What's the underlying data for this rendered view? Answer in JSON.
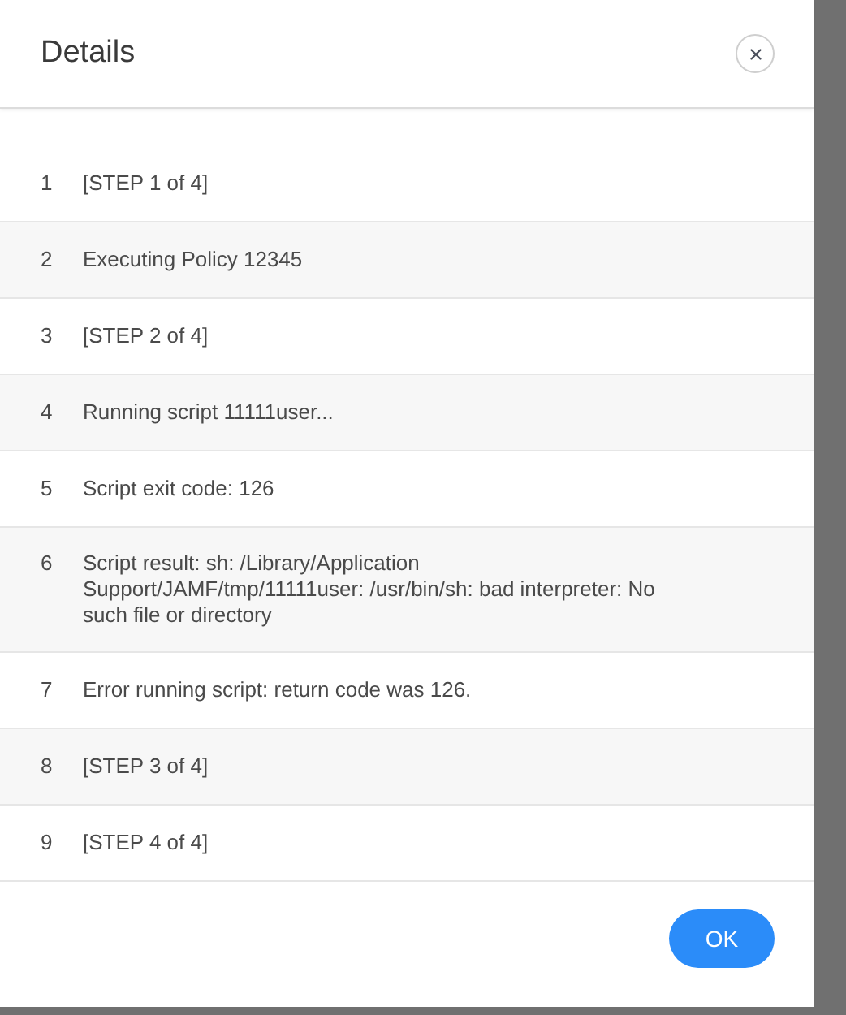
{
  "dialog": {
    "title": "Details",
    "rows": [
      {
        "number": "1",
        "text": "[STEP 1 of 4]"
      },
      {
        "number": "2",
        "text": "Executing Policy 12345"
      },
      {
        "number": "3",
        "text": "[STEP 2 of 4]"
      },
      {
        "number": "4",
        "text": "Running script 11111user..."
      },
      {
        "number": "5",
        "text": "Script exit code: 126"
      },
      {
        "number": "6",
        "text": "Script result: sh: /Library/Application Support/JAMF/tmp/11111user: /usr/bin/sh: bad interpreter: No such file or directory"
      },
      {
        "number": "7",
        "text": "Error running script: return code was 126."
      },
      {
        "number": "8",
        "text": "[STEP 3 of 4]"
      },
      {
        "number": "9",
        "text": "[STEP 4 of 4]"
      }
    ],
    "buttons": [
      "OK"
    ]
  }
}
